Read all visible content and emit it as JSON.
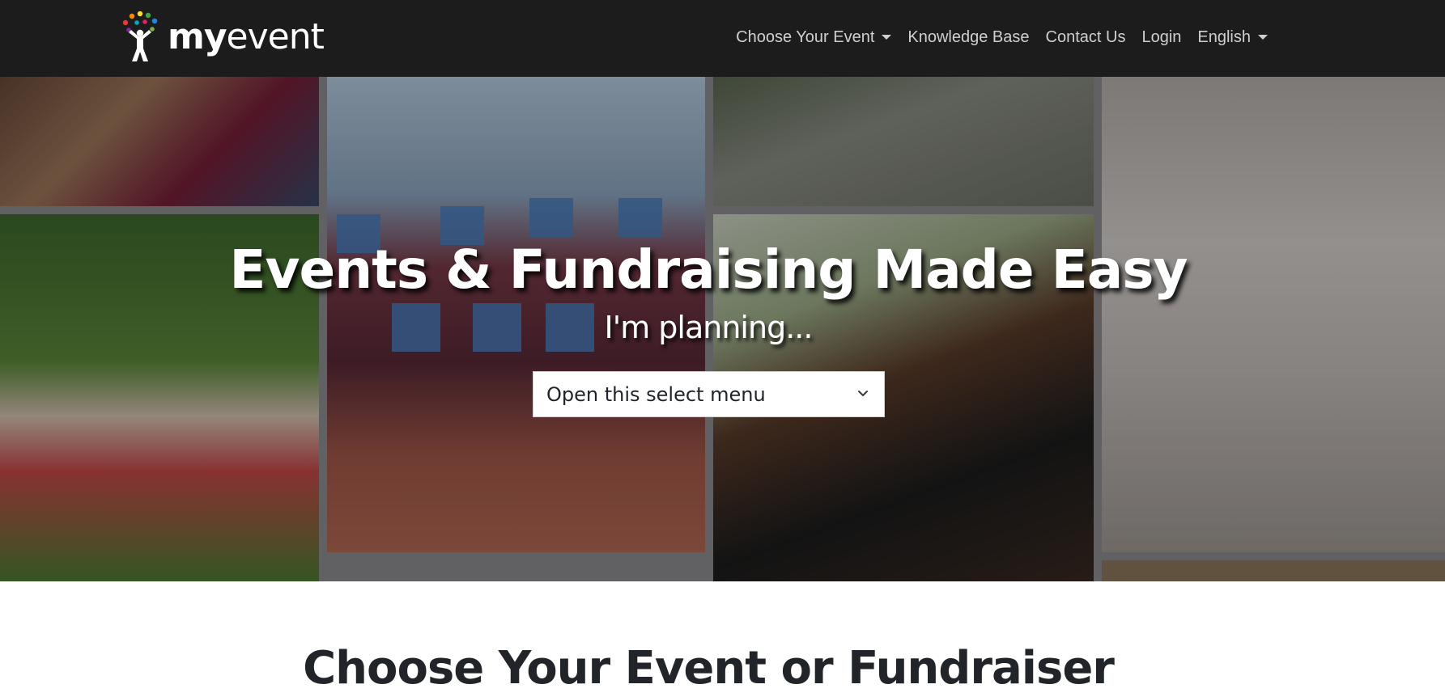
{
  "brand": {
    "name_bold": "my",
    "name_light": "event",
    "logo_icon": "person-celebration-icon"
  },
  "nav": {
    "items": [
      {
        "label": "Choose Your Event",
        "dropdown": true
      },
      {
        "label": "Knowledge Base",
        "dropdown": false
      },
      {
        "label": "Contact Us",
        "dropdown": false
      },
      {
        "label": "Login",
        "dropdown": false
      },
      {
        "label": "English",
        "dropdown": true
      }
    ]
  },
  "hero": {
    "title": "Events & Fundraising Made Easy",
    "subtitle": "I'm planning...",
    "select": {
      "value": "Open this select menu",
      "icon": "chevron-down-icon"
    }
  },
  "section": {
    "heading": "Choose Your Event or Fundraiser"
  },
  "colors": {
    "navbar": "#1c1c1c",
    "nav_text": "#cfcfcf",
    "heading_text": "#212529"
  }
}
